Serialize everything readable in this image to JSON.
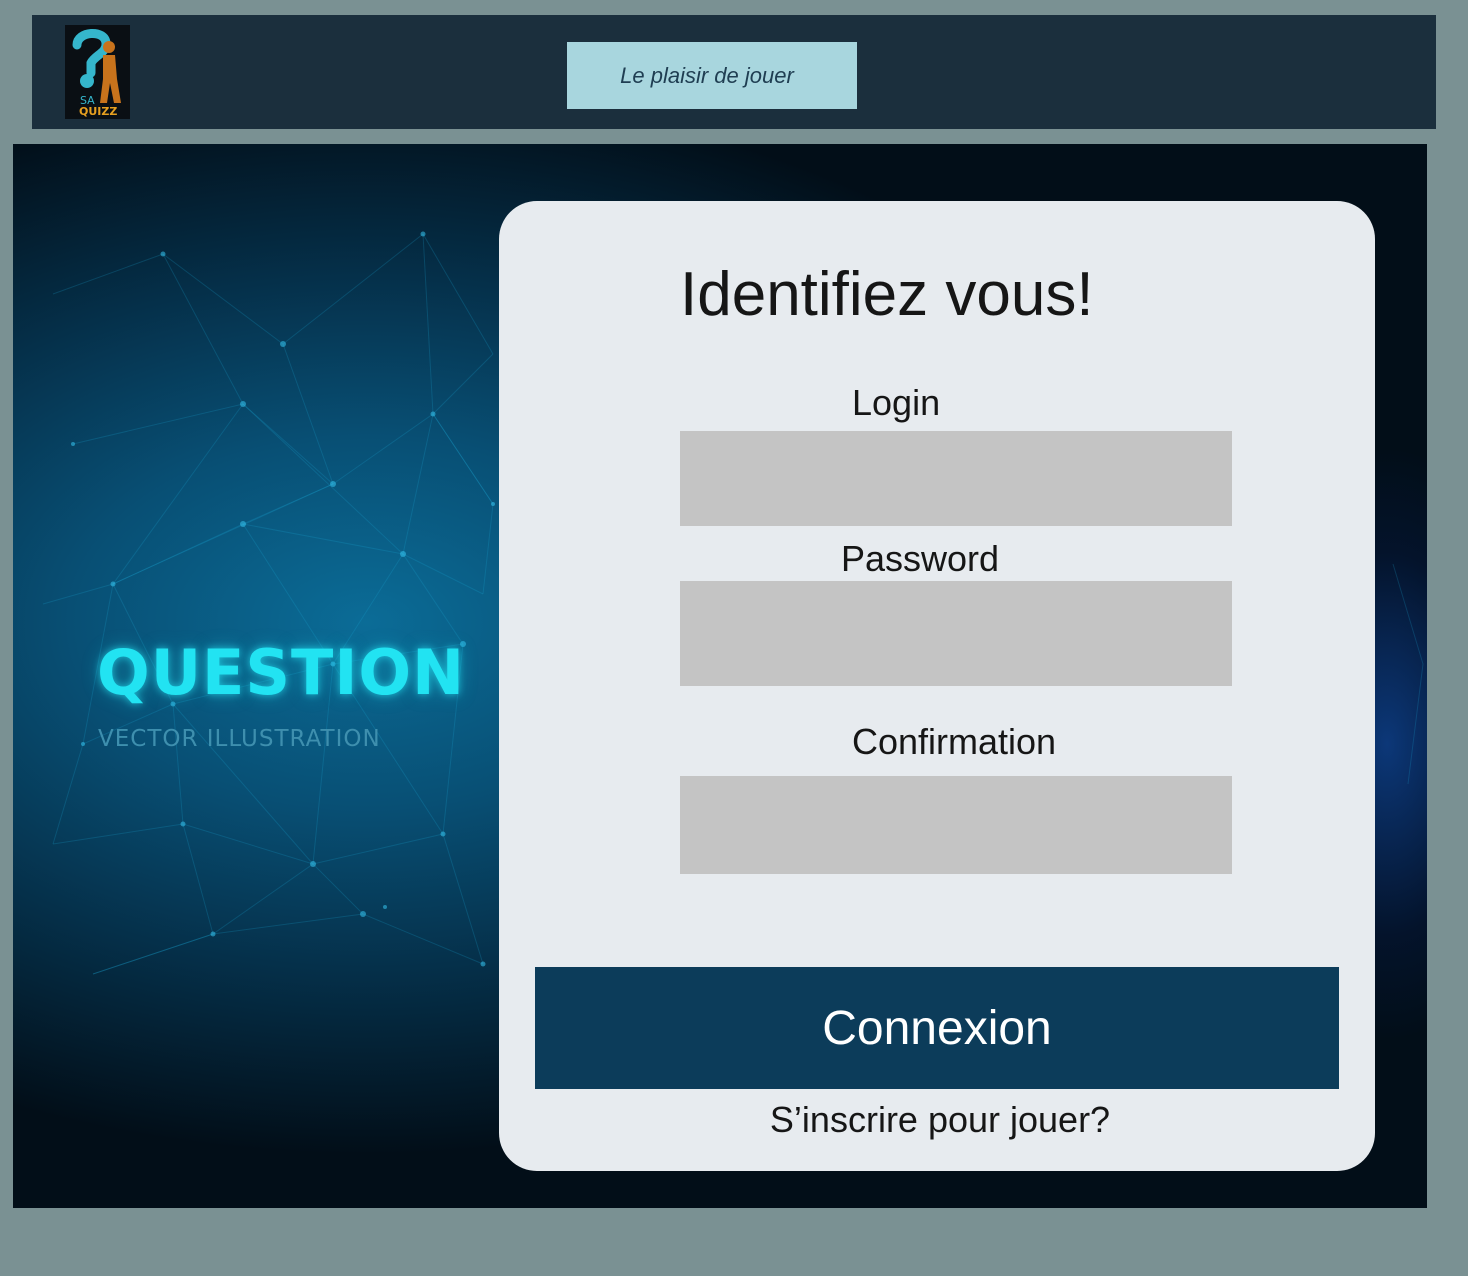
{
  "header": {
    "logo": {
      "line1": "SA",
      "line2": "QUIZZ",
      "icon": "question-mark-person-logo"
    },
    "tagline": "Le plaisir de jouer"
  },
  "hero": {
    "title": "QUESTION",
    "subtitle": "VECTOR ILLUSTRATION"
  },
  "form": {
    "title": "Identifiez vous!",
    "login_label": "Login",
    "login_value": "",
    "password_label": "Password",
    "password_value": "",
    "confirmation_label": "Confirmation",
    "confirmation_value": "",
    "submit_label": "Connexion",
    "signup_link": "S’inscrire pour jouer?"
  },
  "colors": {
    "page_bg": "#7a9193",
    "header_bg": "#1b2f3d",
    "tagline_bg": "#a8d6de",
    "card_bg": "#e7ebef",
    "input_bg": "#c4c4c4",
    "button_bg": "#0c3c5a",
    "accent_cyan": "#22e3f2",
    "logo_orange": "#c8731c"
  }
}
